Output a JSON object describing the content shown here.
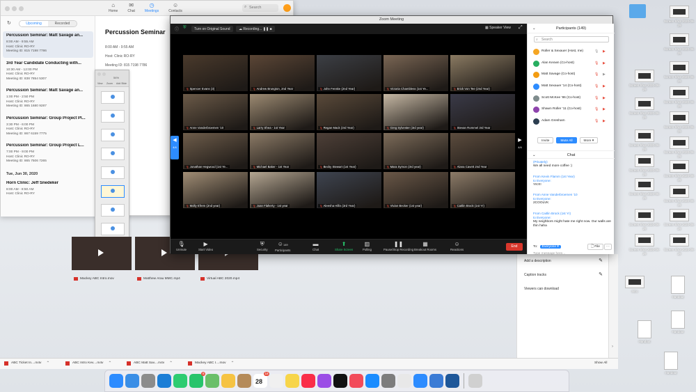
{
  "calendar_window": {
    "toolbar": [
      {
        "icon": "home-icon",
        "label": "Home",
        "glyph": "⌂"
      },
      {
        "icon": "chat-icon",
        "label": "Chat",
        "glyph": "✉"
      },
      {
        "icon": "meetings-icon",
        "label": "Meetings",
        "glyph": "◷",
        "active": true
      },
      {
        "icon": "contacts-icon",
        "label": "Contacts",
        "glyph": "☺"
      }
    ],
    "search_placeholder": "Search",
    "tabs": {
      "upcoming": "Upcoming",
      "recorded": "Recorded"
    },
    "meetings": [
      {
        "title": "Percussion Seminar: Matt Savage an...",
        "time": "8:00 AM - 9:55 AM",
        "host": "Host: Clinic RO-RY",
        "id": "Meeting ID: 815 7198 7786",
        "selected": true
      },
      {
        "title": "3rd Year Candidate Conducting with...",
        "time": "10:30 AM - 12:00 PM",
        "host": "Host: Clinic RO-RY",
        "id": "Meeting ID: 838 7854 5307"
      },
      {
        "title": "Percussion Seminar: Matt Savage an...",
        "time": "1:00 PM - 2:50 PM",
        "host": "Host: Clinic RO-RY",
        "id": "Meeting ID: 865 1680 9287"
      },
      {
        "title": "Percussion Seminar: Group Project Pl...",
        "time": "3:30 PM - 6:00 PM",
        "host": "Host: Clinic RO-RY",
        "id": "Meeting ID: 867 6159 7775"
      },
      {
        "title": "Percussion Seminar: Group Project L...",
        "time": "7:00 PM - 9:00 PM",
        "host": "Host: Clinic RO-RY",
        "id": "Meeting ID: 865 7506 7265"
      }
    ],
    "date_header": "Tue, Jun 30, 2020",
    "next_meeting": {
      "title": "Horn Clinic: Jeff Snedeker",
      "time": "8:00 AM - 8:50 AM",
      "host": "Host: Clinic RO-RY"
    },
    "detail": {
      "title": "Percussion Seminar",
      "time": "8:00 AM - 9:55 AM",
      "host": "Host: Clinic RO-RY",
      "id": "Meeting ID: 815 7198 7786"
    }
  },
  "keynote": {
    "toolbar": [
      "View",
      "Zoom",
      "Add Slide"
    ],
    "zoom": "54%"
  },
  "videos": [
    {
      "name": "Mackey ABC Intro.mov"
    },
    {
      "name": "Matthew Arau MMC.mp4"
    },
    {
      "name": "Virtual ABC 2020.mp4"
    }
  ],
  "right_panel": {
    "add_description": "Add a description",
    "caption_tracks": "Caption tracks",
    "viewers": "Viewers can download"
  },
  "downloads": {
    "items": [
      "ABC Ticket In....m4v",
      "ABC Intro Kev....m4v",
      "ABC Matt Sav....m4v",
      "Mackey ABC I....mov"
    ],
    "show_all": "Show All"
  },
  "zoom": {
    "title": "Zoom Meeting",
    "top_bar": {
      "original_sound": "Turn on Original Sound",
      "recording": "Recording...",
      "speaker_view": "Speaker View"
    },
    "page_left": "4/4",
    "page_right": "4/4",
    "tiles": [
      {
        "name": "Spencer Evans (3)",
        "color": "#4a3a2c"
      },
      {
        "name": "Andrew Brungton, 2nd Year",
        "color": "#5b4636"
      },
      {
        "name": "John Fenske (2nd Year)",
        "color": "#3c3f45"
      },
      {
        "name": "Victoria Chambless (1st Ye...",
        "color": "#7a6654"
      },
      {
        "name": "Erick Von Tee (2nd Year)",
        "color": "#8a7a62"
      },
      {
        "name": "Anne Vanderbroemen '10",
        "color": "#6b5a48"
      },
      {
        "name": "Larry Shea - 1st Year",
        "color": "#9c8a72"
      },
      {
        "name": "Regan Mack (3rd Year)",
        "color": "#5a4a3a"
      },
      {
        "name": "Greg Sylvester (3rd year)",
        "color": "#c6b8a4"
      },
      {
        "name": "Stevan Rommel 3rd Year",
        "color": "#3a3a48"
      },
      {
        "name": "Jonathan Hegwood (1st Ye...",
        "color": "#6e5d4b"
      },
      {
        "name": "Michael Baker - 1st Year",
        "color": "#8b7a66"
      },
      {
        "name": "Becky Stewart (1st Year)",
        "color": "#4e4038"
      },
      {
        "name": "Mara Symon (3rd year)",
        "color": "#7d6c5a"
      },
      {
        "name": "Alana Cavett 2nd Year",
        "color": "#5c4c3e"
      },
      {
        "name": "Molly Efrem (2nd year)",
        "color": "#a08d75"
      },
      {
        "name": "Joan Flaherty - 1st year",
        "color": "#b4a692"
      },
      {
        "name": "Aleesha Hillis (3rd Year)",
        "color": "#3e4450"
      },
      {
        "name": "Vivian Becker (1st year)",
        "color": "#6a5848"
      },
      {
        "name": "Caitlin Brock (1st Yr)",
        "color": "#8c7b68"
      }
    ],
    "bottom_bar": [
      {
        "icon": "unmute-icon",
        "label": "Unmute",
        "glyph": "🎙"
      },
      {
        "icon": "start-video-icon",
        "label": "Start Video",
        "glyph": "▶"
      },
      {
        "icon": "security-icon",
        "label": "Security",
        "glyph": "⛨"
      },
      {
        "icon": "participants-icon",
        "label": "Participants",
        "glyph": "☺",
        "count": "149"
      },
      {
        "icon": "chat-icon",
        "label": "Chat",
        "glyph": "▬"
      },
      {
        "icon": "share-screen-icon",
        "label": "Share Screen",
        "glyph": "⬆",
        "green": true
      },
      {
        "icon": "polling-icon",
        "label": "Polling",
        "glyph": "▥"
      },
      {
        "icon": "pause-recording-icon",
        "label": "Pause/Stop Recording",
        "glyph": "❚❚"
      },
      {
        "icon": "breakout-rooms-icon",
        "label": "Breakout Rooms",
        "glyph": "▦"
      },
      {
        "icon": "reactions-icon",
        "label": "Reactions",
        "glyph": "☺"
      }
    ],
    "end_label": "End",
    "participants": {
      "header": "Participants (149)",
      "search_placeholder": "Search",
      "list": [
        {
          "name": "Roller & Sexauer (Host, me)",
          "color": "#f5a623",
          "mic_on": true,
          "cam_on": false
        },
        {
          "name": "Alan Keown (Co-host)",
          "color": "#27ae60",
          "mic_on": false,
          "cam_on": false
        },
        {
          "name": "Matt Savage (Co-host)",
          "color": "#f39c12",
          "mic_on": false,
          "cam_on": true
        },
        {
          "name": "Matt Sexauer '14 (Co-host)",
          "color": "#2d8cff",
          "mic_on": false,
          "cam_on": false
        },
        {
          "name": "Scott McKee '86 (Co-host)",
          "color": "#7f8c8d",
          "mic_on": false,
          "cam_on": false
        },
        {
          "name": "Shawn Roller '11 (Co-host)",
          "color": "#8e44ad",
          "mic_on": false,
          "cam_on": false
        },
        {
          "name": "Adam Gresham",
          "color": "#2c3e50",
          "mic_on": false,
          "cam_on": false
        }
      ],
      "buttons": {
        "invite": "Invite",
        "mute_all": "Mute All",
        "more": "More ▾"
      }
    },
    "chat": {
      "header": "Chat",
      "messages": [
        {
          "from": "",
          "to": "(Privately)",
          "text": "We all need more coffee :)"
        },
        {
          "from": "From Kevin Flamm (1st Year)",
          "to": "to Everyone:",
          "text": "YK!!!!"
        },
        {
          "from": "From Anne Vanderbroemen '10",
          "to": "to Everyone:",
          "text": "2COOLVK"
        },
        {
          "from": "From Caitlin Brock (1st Yr)",
          "to": "to Everyone:",
          "text": "My neighbors might hate me right now. Our walls are thin haha"
        }
      ],
      "to_label": "To:",
      "to_value": "Everyone ▾",
      "file_label": "File",
      "more": "···",
      "input_placeholder": "Type message here..."
    }
  },
  "dock": {
    "apps": [
      {
        "icon": "safari-icon",
        "color": "#2d8cff"
      },
      {
        "icon": "finder-icon",
        "color": "#3a8ee6"
      },
      {
        "icon": "launchpad-icon",
        "color": "#8c8c8c"
      },
      {
        "icon": "safari-alt-icon",
        "color": "#1c7ed6"
      },
      {
        "icon": "facetime-icon",
        "color": "#2ecc71"
      },
      {
        "icon": "messages-icon",
        "color": "#27c46b",
        "badge": "8"
      },
      {
        "icon": "maps-icon",
        "color": "#6abf69"
      },
      {
        "icon": "photos-icon",
        "color": "#f6c343"
      },
      {
        "icon": "contacts-icon",
        "color": "#b58b5a"
      },
      {
        "icon": "calendar-icon",
        "color": "#ffffff",
        "badge": "18",
        "text": "28"
      },
      {
        "icon": "reminders-icon",
        "color": "#f0f0f0"
      },
      {
        "icon": "notes-icon",
        "color": "#f7d54a"
      },
      {
        "icon": "music-icon",
        "color": "#fa2d48"
      },
      {
        "icon": "podcasts-icon",
        "color": "#9b4de6"
      },
      {
        "icon": "tv-icon",
        "color": "#111111"
      },
      {
        "icon": "news-icon",
        "color": "#f24b5a"
      },
      {
        "icon": "app-store-icon",
        "color": "#1a8cff"
      },
      {
        "icon": "system-preferences-icon",
        "color": "#7d7d7d"
      },
      {
        "icon": "chrome-icon",
        "color": "#e8e8e8"
      },
      {
        "icon": "zoom-icon",
        "color": "#2d8cff"
      },
      {
        "icon": "keynote-icon",
        "color": "#3a7bd5"
      },
      {
        "icon": "quicktime-icon",
        "color": "#1e5799"
      },
      {
        "icon": "trash-icon",
        "color": "#d0d0d0"
      }
    ]
  },
  "desktop_icons": [
    {
      "label": "Screen Shot 2020-06-29",
      "type": "thumb"
    },
    {
      "label": "Screen Shot 2020-06-29",
      "type": "thumb"
    },
    {
      "label": "Screen Shot 2020-06-29",
      "type": "thumb"
    },
    {
      "label": "Screen Shot 2020-06-29",
      "type": "thumb"
    },
    {
      "label": "Screen Shot 2020-06-29",
      "type": "thumb"
    },
    {
      "label": "Screen Shot 2020-06-29",
      "type": "thumb"
    },
    {
      "label": "Screen Shot 2020-06-29",
      "type": "thumb"
    },
    {
      "label": "Screen Shot 2020-06-29",
      "type": "thumb"
    },
    {
      "label": "Screen Shot 2020-06-29",
      "type": "thumb"
    },
    {
      "label": "Screen Shot 2020-06-29",
      "type": "thumb"
    },
    {
      "label": "Screen Shot 2020-06-29",
      "type": "thumb"
    },
    {
      "label": "Screen Shot 2020-06-29",
      "type": "thumb"
    },
    {
      "label": "Screen Shot 2020-06-29",
      "type": "thumb"
    },
    {
      "label": "Screen Shot 2020-06-29",
      "type": "thumb"
    },
    {
      "label": "Screen Shot 2020-06-29",
      "type": "thumb"
    },
    {
      "label": "Screen Shot 2020-06-29",
      "type": "thumb"
    },
    {
      "label": "Screen Shot 2020-06-29",
      "type": "thumb"
    },
    {
      "label": "Intro",
      "type": "thumb"
    },
    {
      "label": "Handout",
      "type": "doc"
    },
    {
      "label": "Handout",
      "type": "doc"
    },
    {
      "label": "Handout",
      "type": "doc"
    },
    {
      "label": "Handout",
      "type": "doc"
    }
  ]
}
